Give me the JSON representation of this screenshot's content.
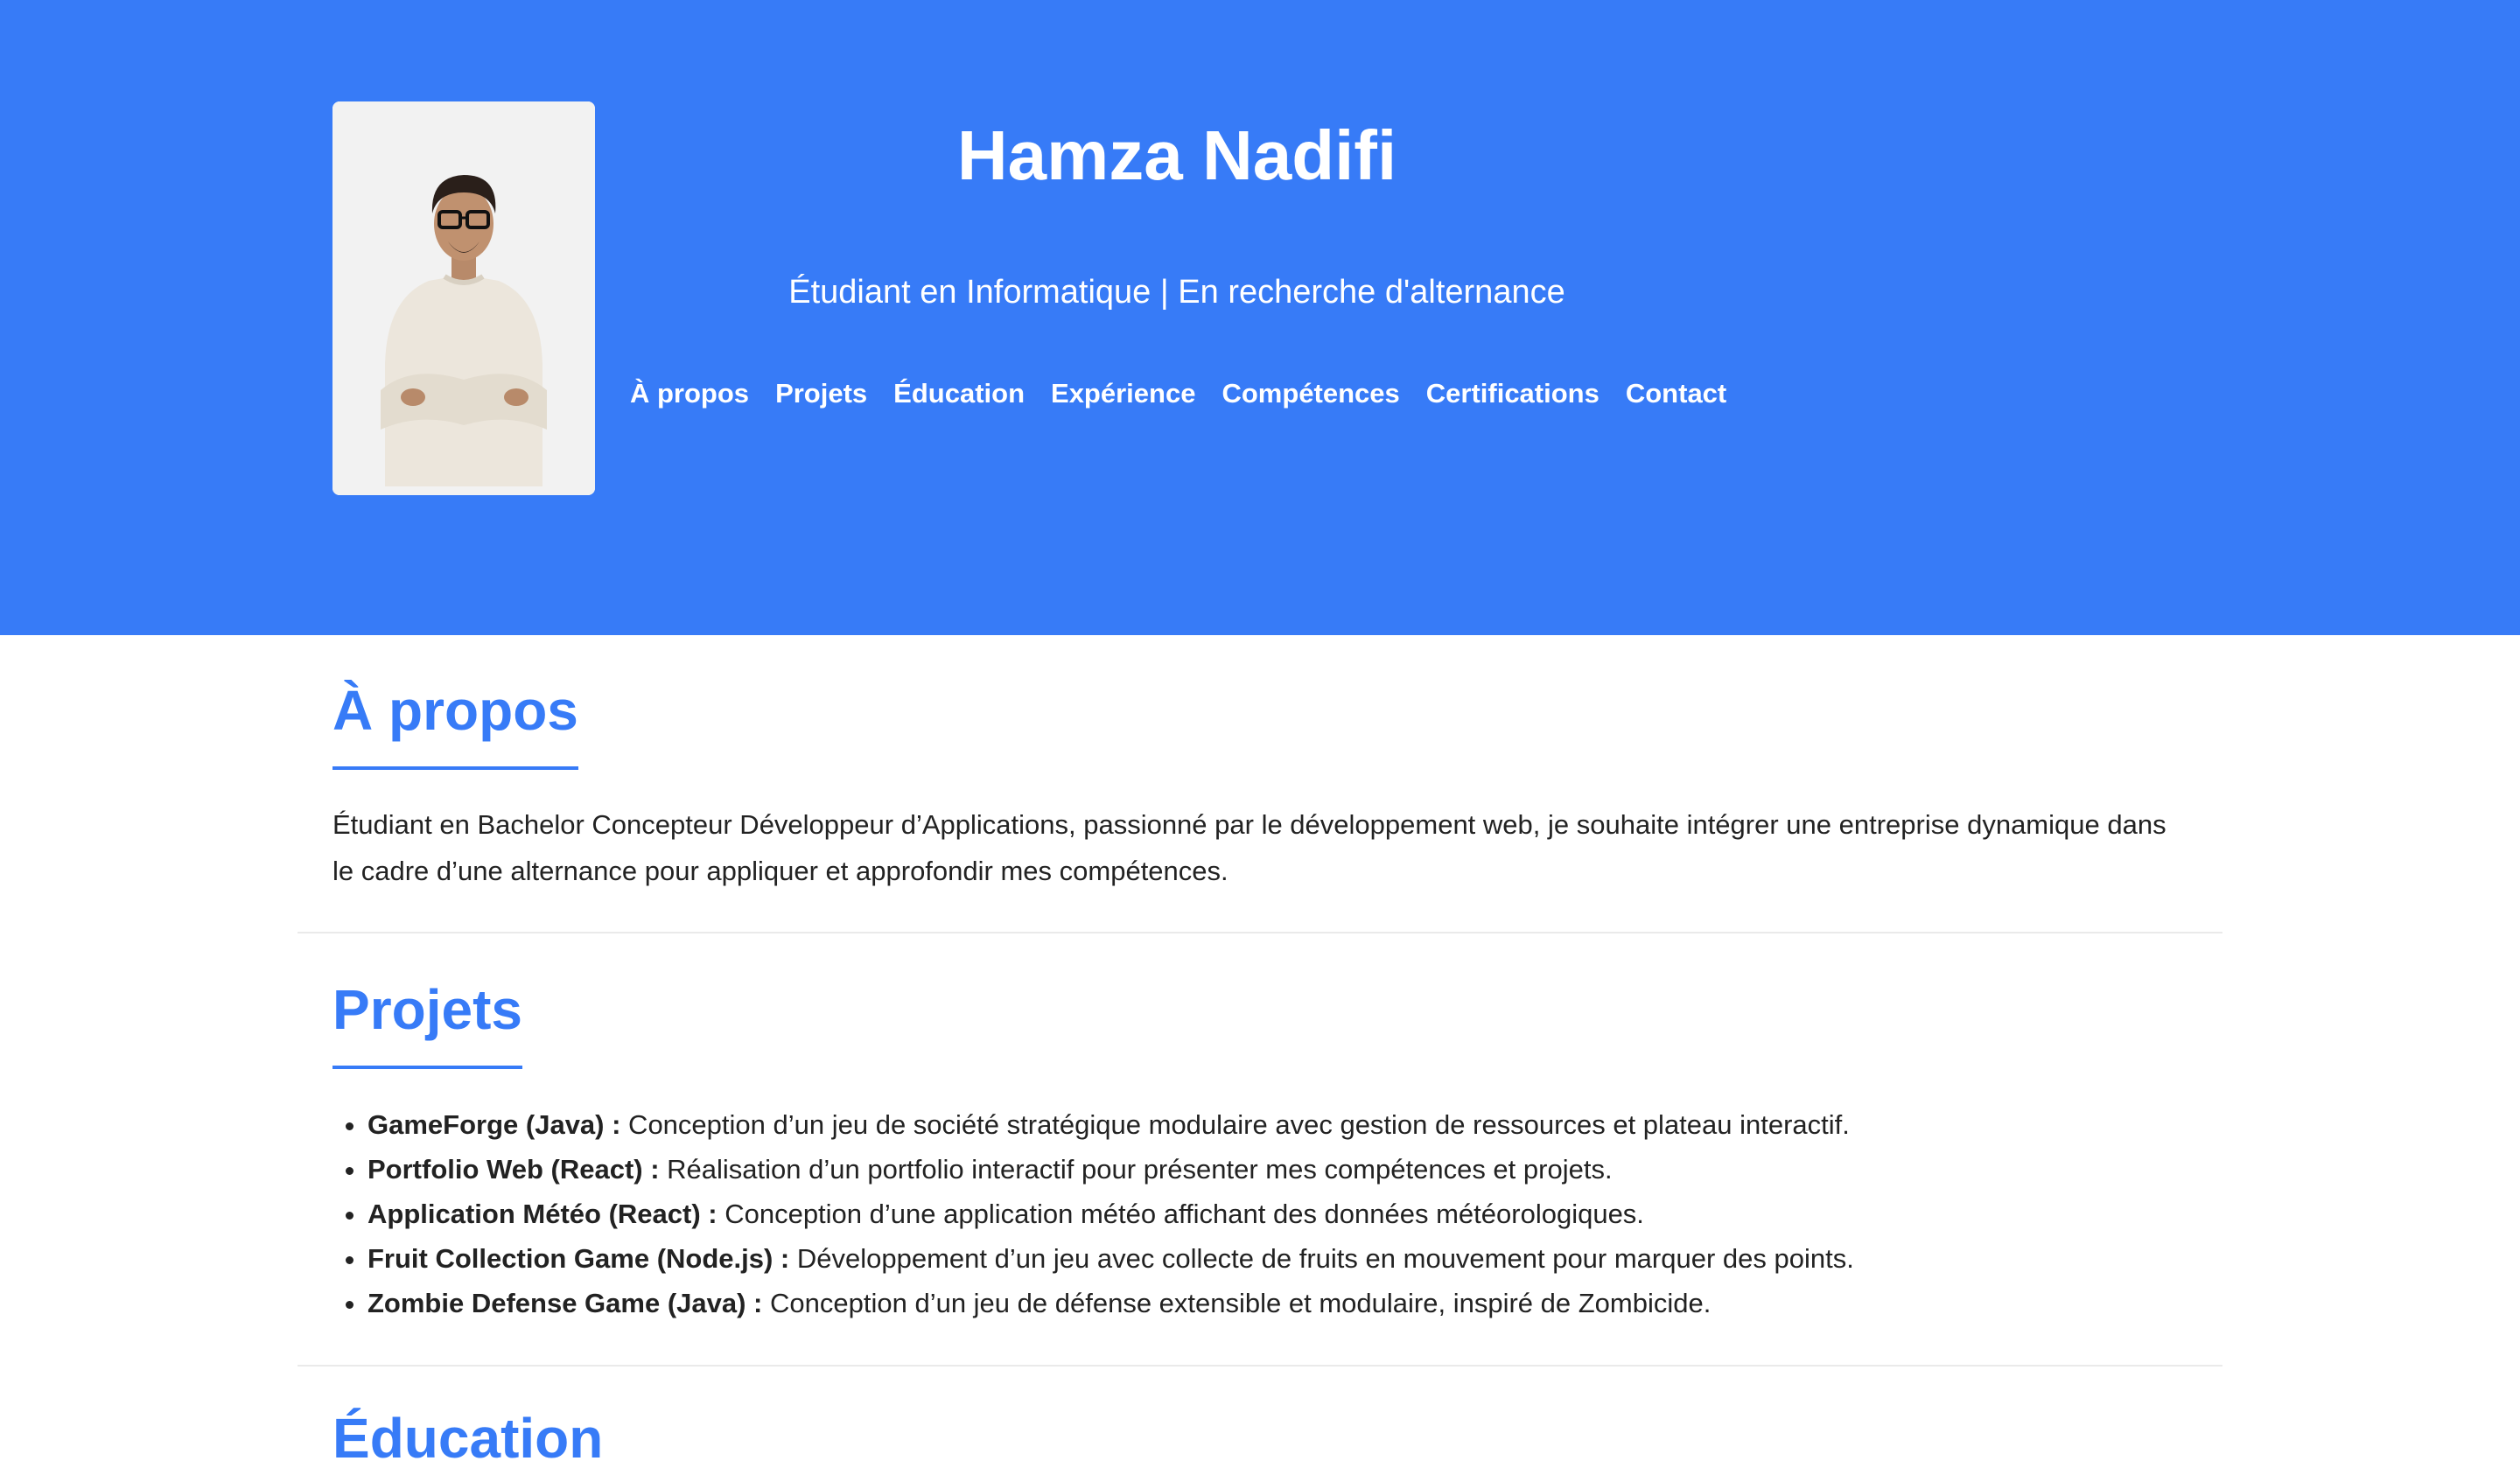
{
  "header": {
    "name": "Hamza Nadifi",
    "subtitle": "Étudiant en Informatique | En recherche d'alternance",
    "nav": [
      "À propos",
      "Projets",
      "Éducation",
      "Expérience",
      "Compétences",
      "Certifications",
      "Contact"
    ]
  },
  "about": {
    "title": "À propos",
    "text": "Étudiant en Bachelor Concepteur Développeur d’Applications, passionné par le développement web, je souhaite intégrer une entreprise dynamique dans le cadre d’une alternance pour appliquer et approfondir mes compétences."
  },
  "projects": {
    "title": "Projets",
    "items": [
      {
        "name": "GameForge (Java) :",
        "description": " Conception d’un jeu de société stratégique modulaire avec gestion de ressources et plateau interactif."
      },
      {
        "name": "Portfolio Web (React) :",
        "description": " Réalisation d’un portfolio interactif pour présenter mes compétences et projets."
      },
      {
        "name": "Application Météo (React) :",
        "description": " Conception d’une application météo affichant des données météorologiques."
      },
      {
        "name": "Fruit Collection Game (Node.js) :",
        "description": " Développement d’un jeu avec collecte de fruits en mouvement pour marquer des points."
      },
      {
        "name": "Zombie Defense Game (Java) :",
        "description": " Conception d’un jeu de défense extensible et modulaire, inspiré de Zombicide."
      }
    ]
  },
  "education": {
    "title": "Éducation"
  },
  "colors": {
    "accent": "#377bf7",
    "text": "#222222",
    "divider": "#eaeaea"
  }
}
